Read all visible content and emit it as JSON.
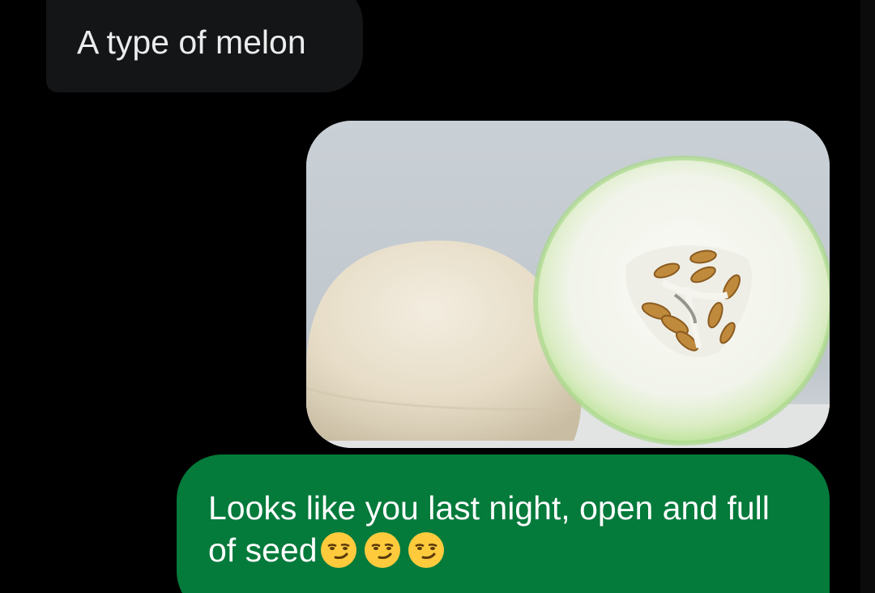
{
  "conversation": {
    "incoming_message": {
      "text": "A type of melon"
    },
    "outgoing_image": {
      "alt": "halved honeydew melon"
    },
    "outgoing_message": {
      "text": "Looks like you last night, open and full of seed",
      "emojis": [
        "smirking-face-emoji",
        "smirking-face-emoji",
        "smirking-face-emoji"
      ]
    }
  },
  "colors": {
    "background": "#000000",
    "incoming_bubble": "#131517",
    "outgoing_bubble": "#047a3b",
    "incoming_text": "#ececec",
    "outgoing_text": "#ffffff"
  }
}
